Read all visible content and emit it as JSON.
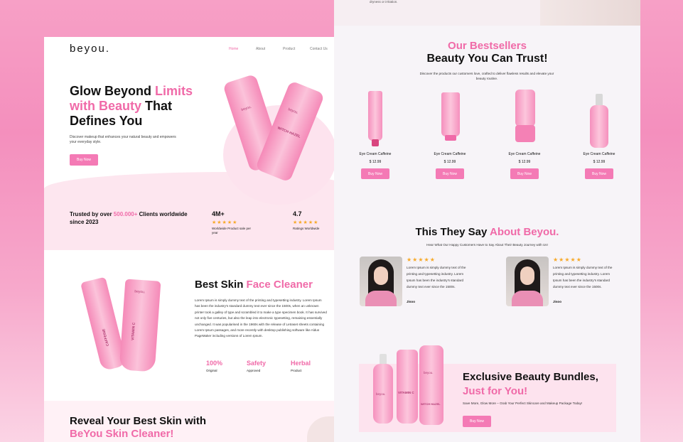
{
  "left": {
    "logo": "beyou.",
    "nav": [
      "Home",
      "About",
      "Product",
      "Contact Us"
    ],
    "hero": {
      "title_a": "Glow Beyond ",
      "title_b": "Limits",
      "title_c": "with Beauty",
      "title_d": " That",
      "title_e": "Defines You",
      "desc": "Discover makeup that enhances your natural beauty and empowers your everyday style.",
      "button": "Buy Now",
      "product_label_a": "beyou.",
      "product_label_b": "WITCH HAZEL"
    },
    "trust": {
      "text_a": "Trusted by over ",
      "text_b": "500.000+",
      "text_c": " Clients worldwide since 2023",
      "stat1_num": "4M+",
      "stat1_stars": "★★★★★",
      "stat1_cap": "Worldwide Product sale per year",
      "stat2_num": "4.7",
      "stat2_stars": "★★★★★",
      "stat2_cap": "Ratings Worldwide"
    },
    "cleaner": {
      "title_a": "Best Skin ",
      "title_b": "Face Cleaner",
      "body": "Lorem Ipsum is simply dummy text of the printing and typesetting industry. Lorem Ipsum has been the industry's standard dummy text ever since the 1500s, when an unknown printer took a galley of type and scrambled it to make a type specimen book. It has survived not only five centuries, but also the leap into electronic typesetting, remaining essentially unchanged. It was popularised in the 1960s with the release of Letraset sheets containing Lorem Ipsum passages, and more recently with desktop publishing software like Aldus PageMaker including versions of Lorem Ipsum.",
      "features": [
        {
          "value": "100%",
          "label": "Original"
        },
        {
          "value": "Safety",
          "label": "Approved"
        },
        {
          "value": "Herbal",
          "label": "Product"
        }
      ],
      "tube_a": "CAFFEINE",
      "tube_b": "VITAMIN C"
    },
    "reveal": {
      "title_a": "Reveal Your Best Skin with",
      "title_b": "BeYou Skin Cleaner!"
    }
  },
  "right": {
    "top_text": "dryness or irritation.",
    "bestsellers": {
      "kicker": "Our Bestsellers",
      "title": "Beauty You Can Trust!",
      "desc": "Discover the products our customers love, crafted to deliver flawless results and elevate your beauty routine.",
      "products": [
        {
          "name": "Eye Cream Caffeine",
          "price": "$ 12.99",
          "button": "Buy Now"
        },
        {
          "name": "Eye Cream Caffeine",
          "price": "$ 12.99",
          "button": "Buy Now"
        },
        {
          "name": "Eye Cream Caffeine",
          "price": "$ 12.99",
          "button": "Buy Now"
        },
        {
          "name": "Eye Cream Caffeine",
          "price": "$ 12.99",
          "button": "Buy Now"
        }
      ]
    },
    "testimonials": {
      "title_a": "This They Say ",
      "title_b": "About  Beyou.",
      "sub": "Hear What Our Happy Customers Have to Say About Their Beauty Journey with Us!",
      "reviews": [
        {
          "stars": "★★★★★",
          "text": "Lorem Ipsum is simply dummy text of the printing and typesetting industry. Lorem Ipsum has been the industry's standard dummy text ever since the 1500s.",
          "name": "Jisoo"
        },
        {
          "stars": "★★★★★",
          "text": "Lorem Ipsum is simply dummy text of the printing and typesetting industry. Lorem Ipsum has been the industry's standard dummy text ever since the 1500s.",
          "name": "Jisoo"
        }
      ]
    },
    "bundle": {
      "title_a": "Exclusive Beauty Bundles,",
      "title_b": "Just for You!",
      "desc": "Save More, Glow More – Grab Your Perfect Skincare and Makeup Package Today!",
      "button": "Buy Now",
      "label_a": "beyou.",
      "label_b": "VITAMIN C",
      "label_c": "WITCH HAZEL"
    }
  }
}
